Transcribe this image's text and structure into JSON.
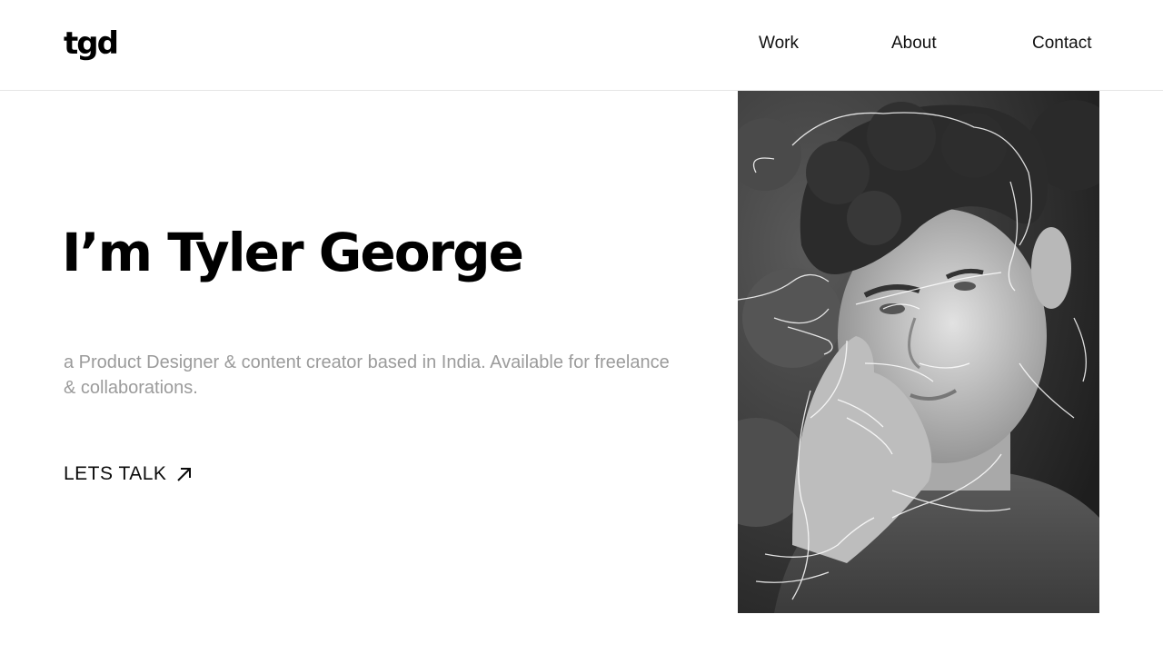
{
  "header": {
    "logo": "tgd",
    "nav": [
      {
        "label": "Work"
      },
      {
        "label": "About"
      },
      {
        "label": "Contact"
      }
    ]
  },
  "hero": {
    "title": "I’m Tyler George",
    "description": "a Product Designer & content creator based in India. Available for freelance & collaborations.",
    "cta_label": "LETS TALK",
    "cta_icon": "arrow-up-right-icon"
  },
  "portrait": {
    "subject": "portrait-photo"
  },
  "colors": {
    "text": "#0b0b0b",
    "muted": "#9b9b9b",
    "background": "#ffffff"
  }
}
